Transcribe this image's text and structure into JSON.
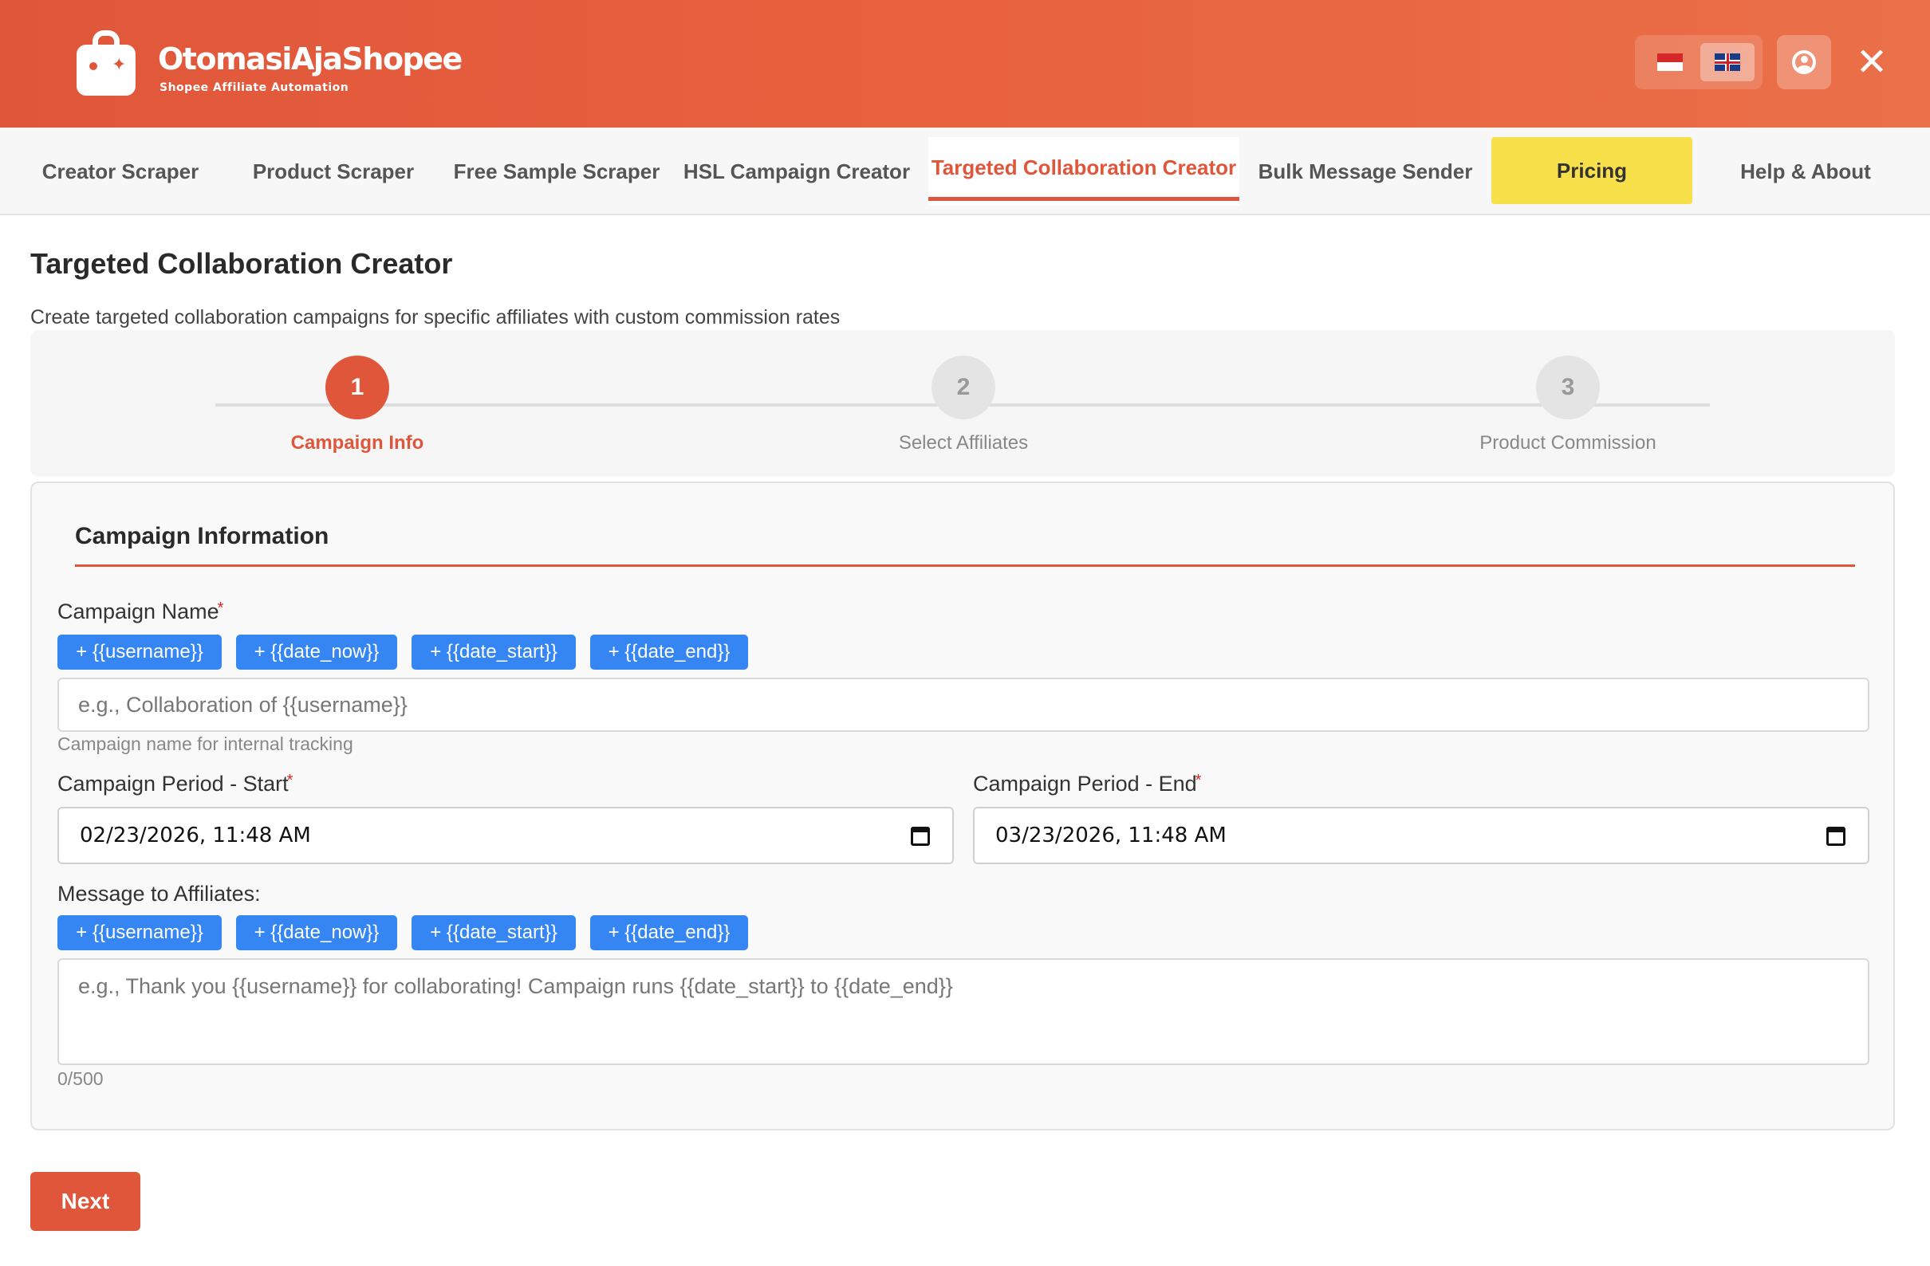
{
  "header": {
    "brand_name": "OtomasiAjaShopee",
    "brand_subtitle": "Shopee Affiliate Automation",
    "languages": [
      {
        "code": "id",
        "icon": "indonesia-flag-icon",
        "active": false
      },
      {
        "code": "en",
        "icon": "uk-flag-icon",
        "active": true
      }
    ],
    "close_symbol": "✕"
  },
  "nav": {
    "tabs": [
      {
        "label": "Creator Scraper",
        "active": false
      },
      {
        "label": "Product Scraper",
        "active": false
      },
      {
        "label": "Free Sample Scraper",
        "active": false
      },
      {
        "label": "HSL Campaign Creator",
        "active": false
      },
      {
        "label": "Targeted Collaboration Creator",
        "active": true
      },
      {
        "label": "Bulk Message Sender",
        "active": false
      },
      {
        "label": "Pricing",
        "active": false
      },
      {
        "label": "Help & About",
        "active": false
      }
    ]
  },
  "page": {
    "title": "Targeted Collaboration Creator",
    "description": "Create targeted collaboration campaigns for specific affiliates with custom commission rates"
  },
  "stepper": {
    "current_step": 1,
    "steps": [
      {
        "number": "1",
        "label": "Campaign Info"
      },
      {
        "number": "2",
        "label": "Select Affiliates"
      },
      {
        "number": "3",
        "label": "Product Commission"
      }
    ]
  },
  "form": {
    "section_title": "Campaign Information",
    "campaign_name": {
      "label": "Campaign Name",
      "required_mark": "*",
      "chips": [
        "+ {{username}}",
        "+ {{date_now}}",
        "+ {{date_start}}",
        "+ {{date_end}}"
      ],
      "value": "",
      "placeholder": "e.g., Collaboration of {{username}}",
      "hint": "Campaign name for internal tracking"
    },
    "period_start": {
      "label": "Campaign Period - Start",
      "required_mark": "*",
      "value": "02/23/2026, 11:48 AM"
    },
    "period_end": {
      "label": "Campaign Period - End",
      "required_mark": "*",
      "value": "03/23/2026, 11:48 AM"
    },
    "message": {
      "label": "Message to Affiliates:",
      "chips": [
        "+ {{username}}",
        "+ {{date_now}}",
        "+ {{date_start}}",
        "+ {{date_end}}"
      ],
      "value": "",
      "placeholder": "e.g., Thank you {{username}} for collaborating! Campaign runs {{date_start}} to {{date_end}}",
      "counter": "0/500"
    }
  },
  "actions": {
    "next_label": "Next"
  },
  "colors": {
    "brand": "#e0563a",
    "chip": "#3585f2",
    "pricing_bg": "#f8e04a"
  }
}
